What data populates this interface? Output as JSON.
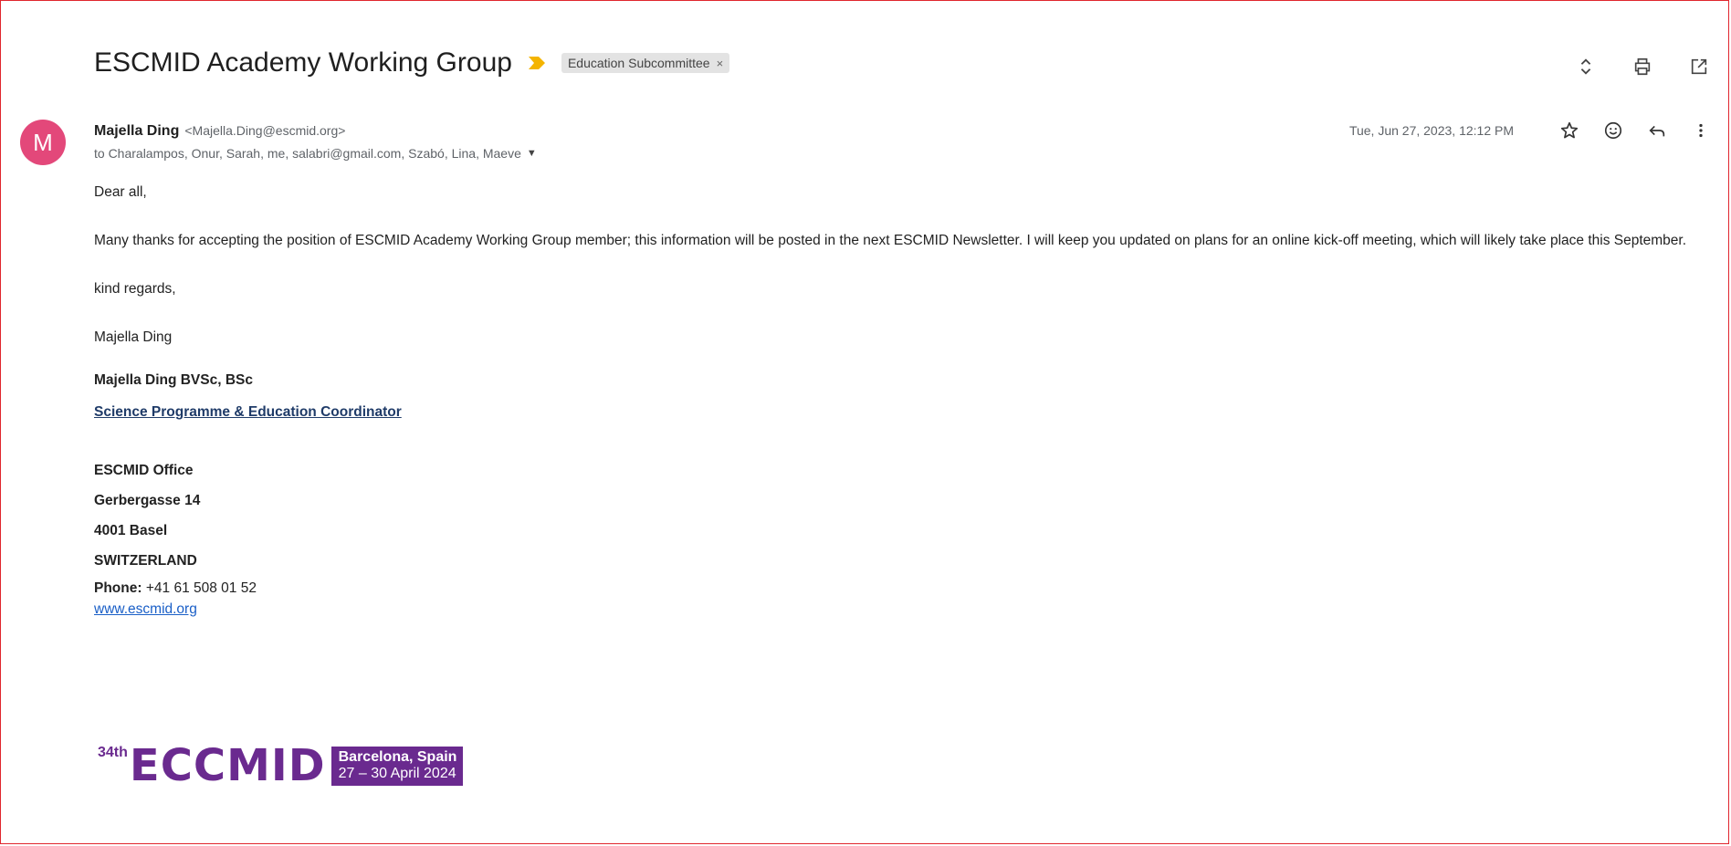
{
  "subject": "ESCMID Academy Working Group",
  "label": "Education Subcommittee",
  "label_remove": "×",
  "sender": {
    "avatar_letter": "M",
    "name": "Majella Ding",
    "email": "<Majella.Ding@escmid.org>",
    "recipients": "to Charalampos, Onur, Sarah, me, salabri@gmail.com, Szabó, Lina, Maeve",
    "date": "Tue, Jun 27, 2023, 12:12 PM"
  },
  "body": {
    "greeting": "Dear all,",
    "paragraph": "Many thanks for accepting the position of ESCMID Academy Working Group member; this information will be posted in the next ESCMID Newsletter. I will keep you updated on plans for an online kick-off meeting, which will likely take place this September.",
    "closing": "kind regards,",
    "signoff": "Majella Ding"
  },
  "signature": {
    "name": "Majella Ding BVSc, BSc",
    "title": "Science Programme & Education Coordinator",
    "office": "ESCMID Office",
    "street": "Gerbergasse 14",
    "city": "4001 Basel",
    "country": "SWITZERLAND",
    "phone_label": "Phone:",
    "phone": "+41 61 508 01 52",
    "website": "www.escmid.org"
  },
  "banner": {
    "ordinal": "34th",
    "brand": "ECCMID",
    "city": "Barcelona, Spain",
    "dates": "27 – 30 April 2024"
  },
  "icons": {
    "top": [
      "expand-collapse-icon",
      "print-icon",
      "open-in-new-window-icon"
    ],
    "meta": [
      "star-icon",
      "emoji-reaction-icon",
      "reply-icon",
      "more-options-icon"
    ]
  },
  "colors": {
    "avatar": "#e3487a",
    "importance": "#f4b400",
    "link": "#1a5fc7",
    "banner_purple": "#6a2a8f",
    "frame_border": "#e0262e"
  }
}
